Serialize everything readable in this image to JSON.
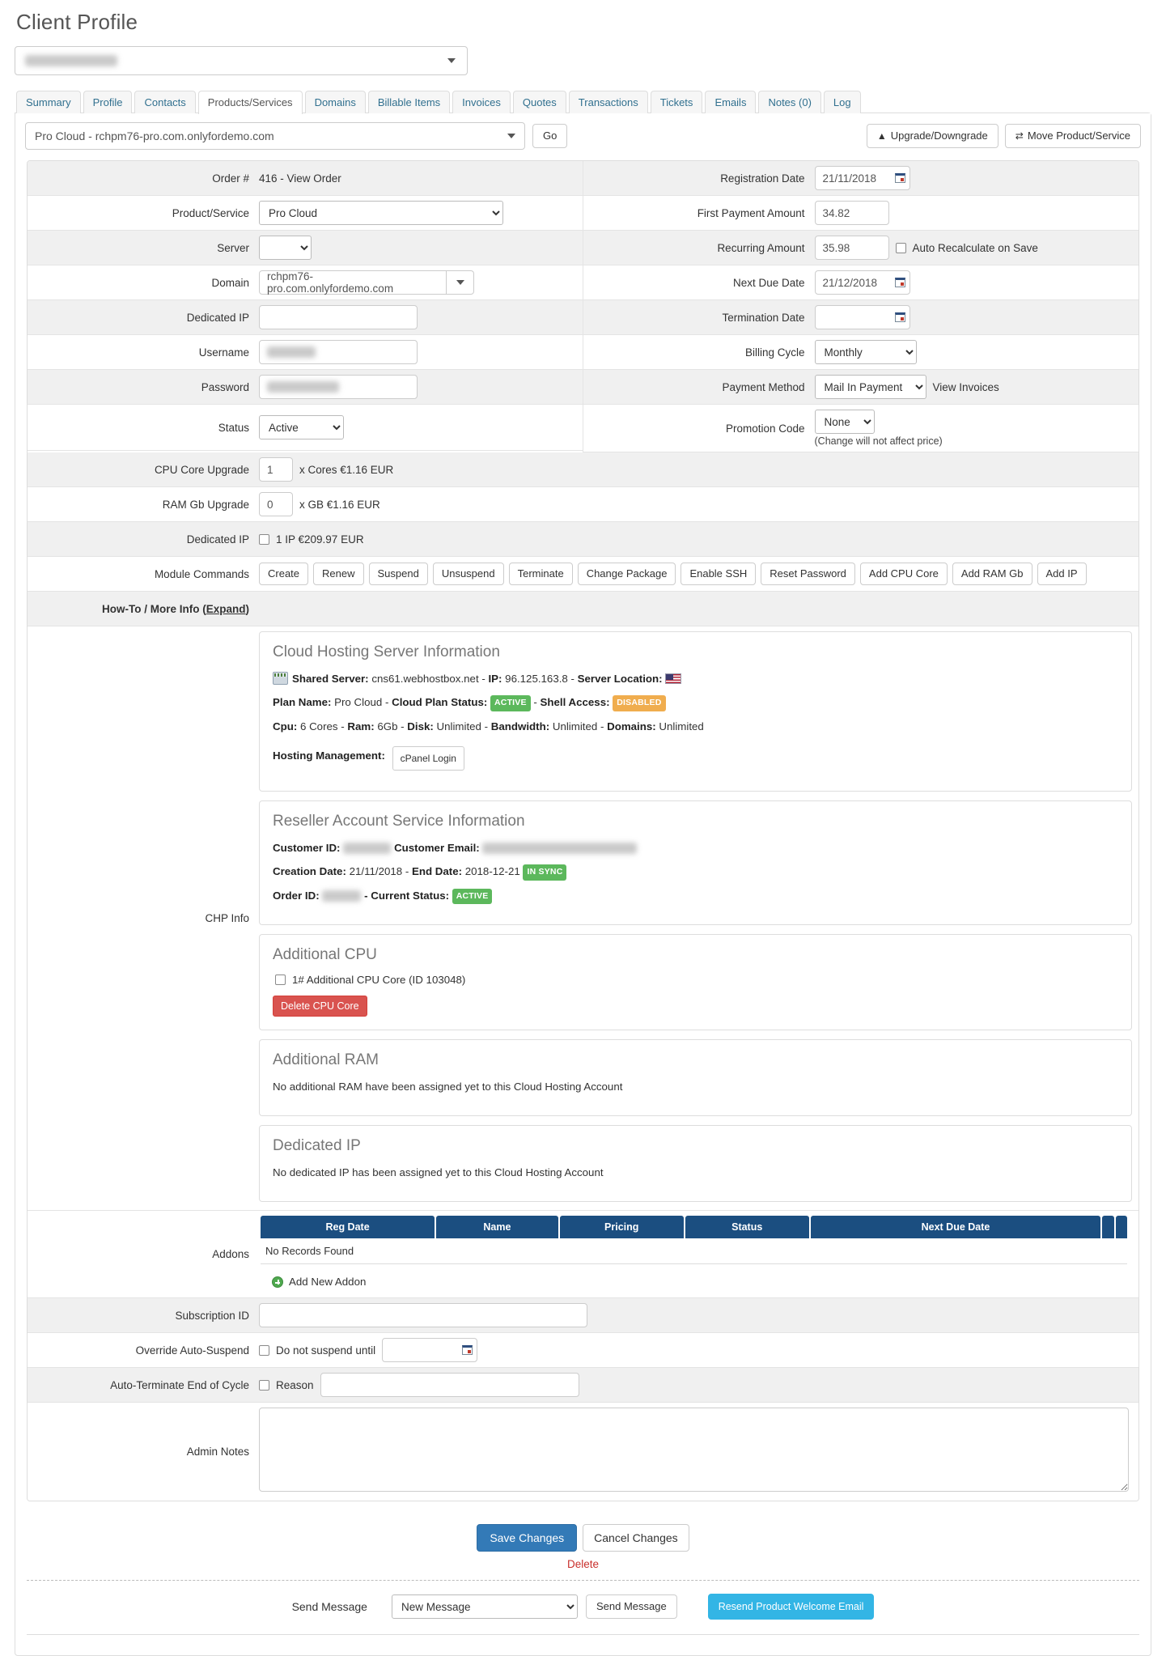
{
  "header": {
    "page_title": "Client Profile",
    "client_name_redacted": "Grielle Rayode  Bri"
  },
  "tabs": [
    {
      "label": "Summary",
      "active": false
    },
    {
      "label": "Profile",
      "active": false
    },
    {
      "label": "Contacts",
      "active": false
    },
    {
      "label": "Products/Services",
      "active": true
    },
    {
      "label": "Domains",
      "active": false
    },
    {
      "label": "Billable Items",
      "active": false
    },
    {
      "label": "Invoices",
      "active": false
    },
    {
      "label": "Quotes",
      "active": false
    },
    {
      "label": "Transactions",
      "active": false
    },
    {
      "label": "Tickets",
      "active": false
    },
    {
      "label": "Emails",
      "active": false
    },
    {
      "label": "Notes (0)",
      "active": false
    },
    {
      "label": "Log",
      "active": false
    }
  ],
  "toolbar": {
    "service_selected": "Pro Cloud - rchpm76-pro.com.onlyfordemo.com",
    "go_label": "Go",
    "upgrade_label": "Upgrade/Downgrade",
    "move_label": "Move Product/Service",
    "upgrade_icon": "arrow-up-circle-icon",
    "move_icon": "shuffle-icon"
  },
  "form": {
    "left": {
      "order_label": "Order #",
      "order_value": "416 - View Order",
      "product_label": "Product/Service",
      "product_value": "Pro Cloud",
      "server_label": "Server",
      "server_value": "",
      "domain_label": "Domain",
      "domain_value": "rchpm76-pro.com.onlyfordemo.com",
      "dedicated_ip_label": "Dedicated IP",
      "dedicated_ip_value": "",
      "username_label": "Username",
      "username_value_redacted": "rchpmd4g",
      "password_label": "Password",
      "password_value_redacted": "j3kf9aiWq1-7kl",
      "status_label": "Status",
      "status_value": "Active"
    },
    "right": {
      "registration_date_label": "Registration Date",
      "registration_date_value": "21/11/2018",
      "first_payment_label": "First Payment Amount",
      "first_payment_value": "34.82",
      "recurring_label": "Recurring Amount",
      "recurring_value": "35.98",
      "auto_recalc_label": "Auto Recalculate on Save",
      "next_due_label": "Next Due Date",
      "next_due_value": "21/12/2018",
      "termination_label": "Termination Date",
      "termination_value": "",
      "billing_cycle_label": "Billing Cycle",
      "billing_cycle_value": "Monthly",
      "payment_method_label": "Payment Method",
      "payment_method_value": "Mail In Payment",
      "view_invoices_label": "View Invoices",
      "promotion_label": "Promotion Code",
      "promotion_value": "None",
      "promotion_note": "(Change will not affect price)"
    },
    "upgrades": {
      "cpu_label": "CPU Core Upgrade",
      "cpu_value": "1",
      "cpu_suffix": "x Cores €1.16 EUR",
      "ram_label": "RAM Gb Upgrade",
      "ram_value": "0",
      "ram_suffix": "x GB €1.16 EUR",
      "dedip_label": "Dedicated IP",
      "dedip_suffix": "1 IP €209.97 EUR",
      "module_label": "Module Commands",
      "module_buttons": [
        "Create",
        "Renew",
        "Suspend",
        "Unsuspend",
        "Terminate",
        "Change Package",
        "Enable SSH",
        "Reset Password",
        "Add CPU Core",
        "Add RAM Gb",
        "Add IP"
      ],
      "howto_label": "How-To / More Info (",
      "howto_link": "Expand",
      "howto_label_end": ")"
    },
    "chp": {
      "label": "CHP Info",
      "server_info": {
        "title": "Cloud Hosting Server Information",
        "server_icon": "server-icon",
        "shared_server_label": "Shared Server:",
        "shared_server_value": "cns61.webhostbox.net",
        "ip_label": "IP:",
        "ip_value": "96.125.163.8",
        "server_location_label": "Server Location:",
        "server_location_flag": "us-flag-icon",
        "plan_name_label": "Plan Name:",
        "plan_name_value": "Pro Cloud",
        "cloud_status_label": "Cloud Plan Status:",
        "cloud_status_badge": "ACTIVE",
        "shell_label": "Shell Access:",
        "shell_badge": "DISABLED",
        "cpu_label": "Cpu:",
        "cpu_value": "6 Cores",
        "ram_label": "Ram:",
        "ram_value": "6Gb",
        "disk_label": "Disk:",
        "disk_value": "Unlimited",
        "bandwidth_label": "Bandwidth:",
        "bandwidth_value": "Unlimited",
        "domains_label": "Domains:",
        "domains_value": "Unlimited",
        "hosting_mgmt_label": "Hosting Management:",
        "cpanel_button": "cPanel Login"
      },
      "reseller_info": {
        "title": "Reseller Account Service Information",
        "customer_id_label": "Customer ID:",
        "customer_id_redacted": "18274035",
        "customer_email_label": "Customer Email:",
        "customer_email_redacted": "g.hopopq@informaticaferrara.es",
        "creation_date_label": "Creation Date:",
        "creation_date_value": "21/11/2018",
        "end_date_label": "End Date:",
        "end_date_value": "2018-12-21",
        "sync_badge": "IN SYNC",
        "order_id_label": "Order ID:",
        "order_id_redacted": "54039  0",
        "current_status_label": "- Current Status:",
        "current_status_badge": "ACTIVE"
      },
      "additional_cpu": {
        "title": "Additional CPU",
        "item_label": "1# Additional CPU Core (ID 103048)",
        "delete_button": "Delete CPU Core"
      },
      "additional_ram": {
        "title": "Additional RAM",
        "empty_text": "No additional RAM have been assigned yet to this Cloud Hosting Account"
      },
      "dedicated_ip": {
        "title": "Dedicated IP",
        "empty_text": "No dedicated IP has been assigned yet to this Cloud Hosting Account"
      }
    },
    "addons": {
      "label": "Addons",
      "columns": [
        "Reg Date",
        "Name",
        "Pricing",
        "Status",
        "Next Due Date",
        "",
        "",
        ""
      ],
      "empty_text": "No Records Found",
      "add_label": "Add New Addon",
      "add_icon": "plus-circle-icon"
    },
    "bottom": {
      "subscription_label": "Subscription ID",
      "subscription_value": "",
      "override_label": "Override Auto-Suspend",
      "override_checkbox_label": "Do not suspend until",
      "override_date_value": "",
      "autoterm_label": "Auto-Terminate End of Cycle",
      "autoterm_checkbox_label": "Reason",
      "autoterm_reason_value": "",
      "admin_notes_label": "Admin Notes",
      "admin_notes_value": ""
    }
  },
  "actions": {
    "save_label": "Save Changes",
    "cancel_label": "Cancel Changes",
    "delete_label": "Delete"
  },
  "send_message": {
    "label": "Send Message",
    "select_value": "New Message",
    "send_button": "Send Message",
    "resend_button": "Resend Product Welcome Email"
  },
  "colors": {
    "primary": "#337ab7",
    "table_header": "#1b4e80",
    "danger": "#d9534f",
    "success": "#5cb85c",
    "warning": "#f0ad4e",
    "info": "#33b5e5",
    "delete_link": "#c9302c"
  }
}
